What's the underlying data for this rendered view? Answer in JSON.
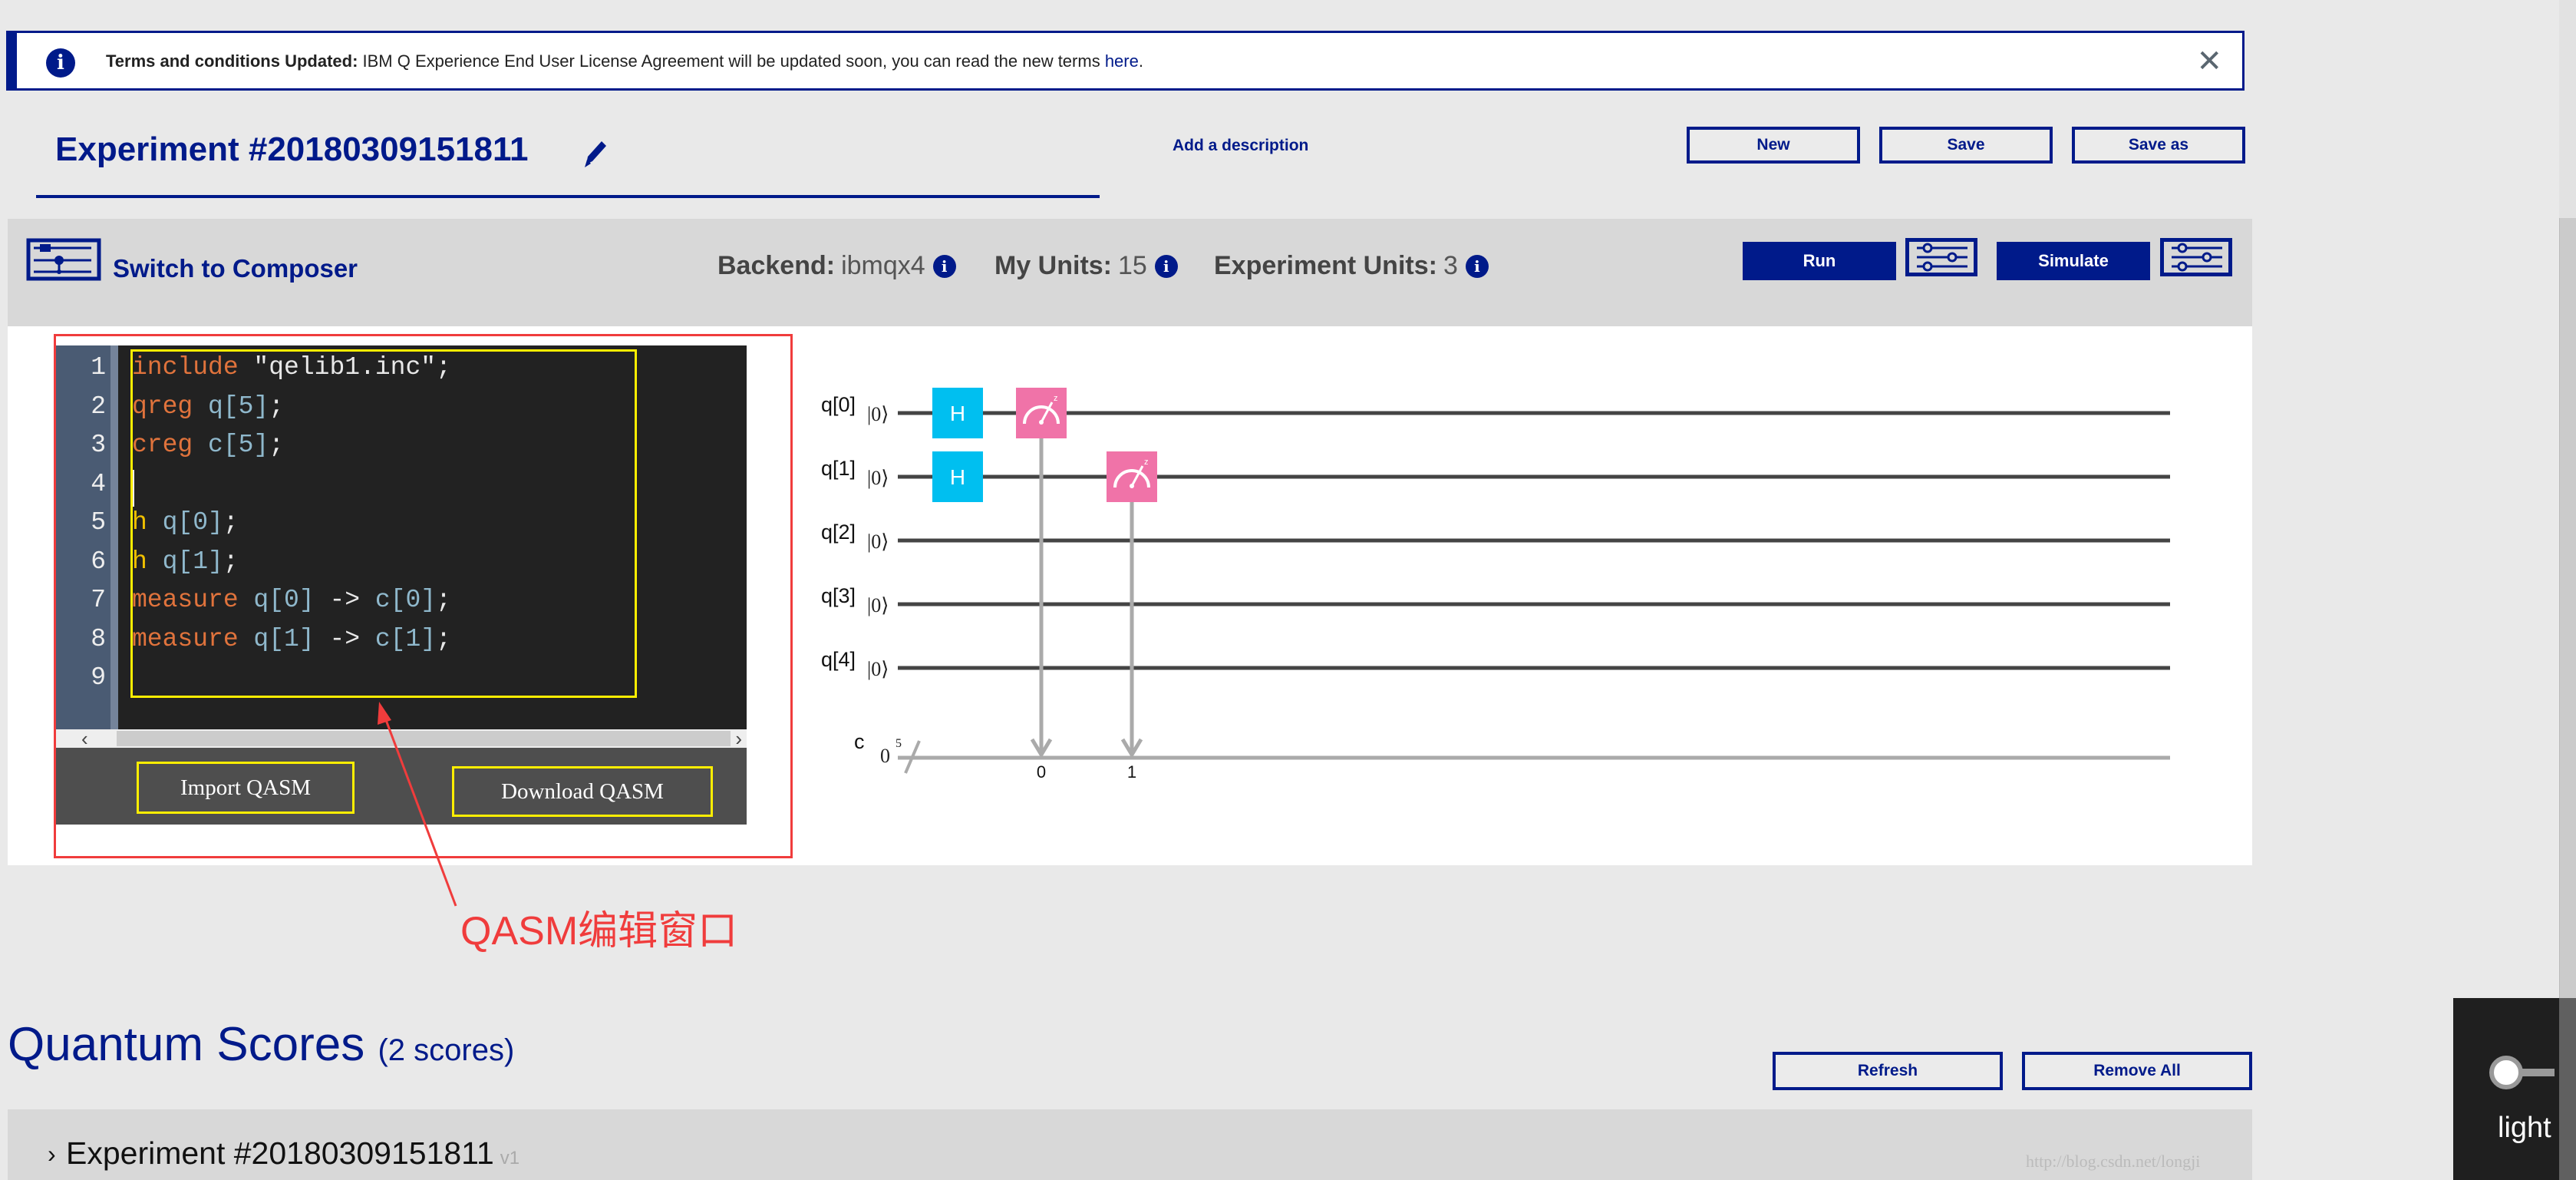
{
  "banner": {
    "bold": "Terms and conditions Updated:",
    "text": " IBM Q Experience End User License Agreement will be updated soon, you can read the new terms ",
    "link": "here",
    "tail": ".",
    "close": "✕"
  },
  "header": {
    "title": "Experiment #20180309151811",
    "add_description": "Add a description",
    "buttons": {
      "new": "New",
      "save": "Save",
      "save_as": "Save as"
    }
  },
  "toolbar": {
    "switch_label": "Switch to Composer",
    "backend_label": "Backend:",
    "backend_value": "ibmqx4",
    "my_units_label": "My Units:",
    "my_units_value": "15",
    "exp_units_label": "Experiment Units:",
    "exp_units_value": "3",
    "info_glyph": "i",
    "run": "Run",
    "simulate": "Simulate"
  },
  "editor": {
    "line_numbers": [
      "1",
      "2",
      "3",
      "4",
      "5",
      "6",
      "7",
      "8",
      "9"
    ],
    "lines": [
      [
        {
          "t": "include",
          "c": "kw"
        },
        {
          "t": " \"qelib1.inc\";",
          "c": ""
        }
      ],
      [
        {
          "t": "qreg",
          "c": "kw"
        },
        {
          "t": " q[5]",
          "c": "id"
        },
        {
          "t": ";",
          "c": ""
        }
      ],
      [
        {
          "t": "creg",
          "c": "kw"
        },
        {
          "t": " c[5]",
          "c": "id"
        },
        {
          "t": ";",
          "c": ""
        }
      ],
      [],
      [
        {
          "t": "h",
          "c": "gate"
        },
        {
          "t": " q[0]",
          "c": "id"
        },
        {
          "t": ";",
          "c": ""
        }
      ],
      [
        {
          "t": "h",
          "c": "gate"
        },
        {
          "t": " q[1]",
          "c": "id"
        },
        {
          "t": ";",
          "c": ""
        }
      ],
      [
        {
          "t": "measure",
          "c": "kw"
        },
        {
          "t": " q[0]",
          "c": "id"
        },
        {
          "t": " -> ",
          "c": ""
        },
        {
          "t": "c[0]",
          "c": "id"
        },
        {
          "t": ";",
          "c": ""
        }
      ],
      [
        {
          "t": "measure",
          "c": "kw"
        },
        {
          "t": " q[1]",
          "c": "id"
        },
        {
          "t": " -> ",
          "c": ""
        },
        {
          "t": "c[1]",
          "c": "id"
        },
        {
          "t": ";",
          "c": ""
        }
      ],
      []
    ],
    "import_label": "Import QASM",
    "download_label": "Download QASM",
    "scroll_left": "‹",
    "scroll_right": "›"
  },
  "annotation": "QASM编辑窗口",
  "circuit": {
    "qubits": [
      "q[0]",
      "q[1]",
      "q[2]",
      "q[3]",
      "q[4]"
    ],
    "ket": "|0⟩",
    "classical_label": "c",
    "classical_init": "0",
    "classical_width": "5",
    "gates": [
      {
        "type": "H",
        "qubit": 0,
        "col": 0,
        "label": "H"
      },
      {
        "type": "H",
        "qubit": 1,
        "col": 0,
        "label": "H"
      },
      {
        "type": "measure",
        "qubit": 0,
        "col": 1,
        "cbit": "0"
      },
      {
        "type": "measure",
        "qubit": 1,
        "col": 2,
        "cbit": "1"
      }
    ],
    "colors": {
      "h": "#00bff0",
      "measure": "#f073a8",
      "wire": "#444444",
      "classical": "#aaaaaa"
    }
  },
  "scores": {
    "title": "Quantum Scores",
    "count": "(2 scores)",
    "refresh": "Refresh",
    "remove_all": "Remove All",
    "items": [
      {
        "chevron": "›",
        "name": "Experiment #20180309151811",
        "version": "v1"
      }
    ]
  },
  "theme_toggle": {
    "label": "light"
  },
  "watermark": "http://blog.csdn.net/longji",
  "colors": {
    "brand": "#001a8a",
    "annotation_red": "#f03c3c",
    "highlight_yellow": "#ffee00"
  }
}
